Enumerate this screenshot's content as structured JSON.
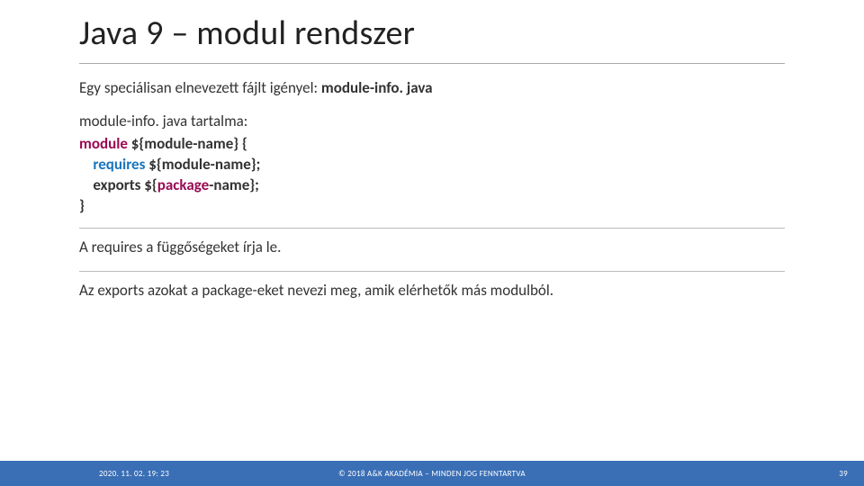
{
  "title": "Java 9 – modul rendszer",
  "intro_prefix": "Egy speciálisan elnevezett fájlt igényel: ",
  "intro_bold": "module-info. java",
  "contents_label": "module-info. java tartalma:",
  "code": {
    "l1_kw": "module",
    "l1_rest": " ${module-name} {",
    "l2_indent": "    ",
    "l2_kw": "requires",
    "l2_rest": " ${module-name};",
    "l3_indent": "    ",
    "l3_kw": "exports",
    "l3_mid": " ${",
    "l3_pkg": "package",
    "l3_rest": "-name};",
    "l4": "}"
  },
  "para_requires": "A requires a függőségeket írja le.",
  "para_exports": "Az exports azokat a package-eket nevezi meg, amik elérhetők más modulból.",
  "footer": {
    "timestamp": "2020. 11. 02. 19: 23",
    "copyright": "© 2018 A&K AKADÉMIA – MINDEN JOG FENNTARTVA",
    "page": "39"
  }
}
